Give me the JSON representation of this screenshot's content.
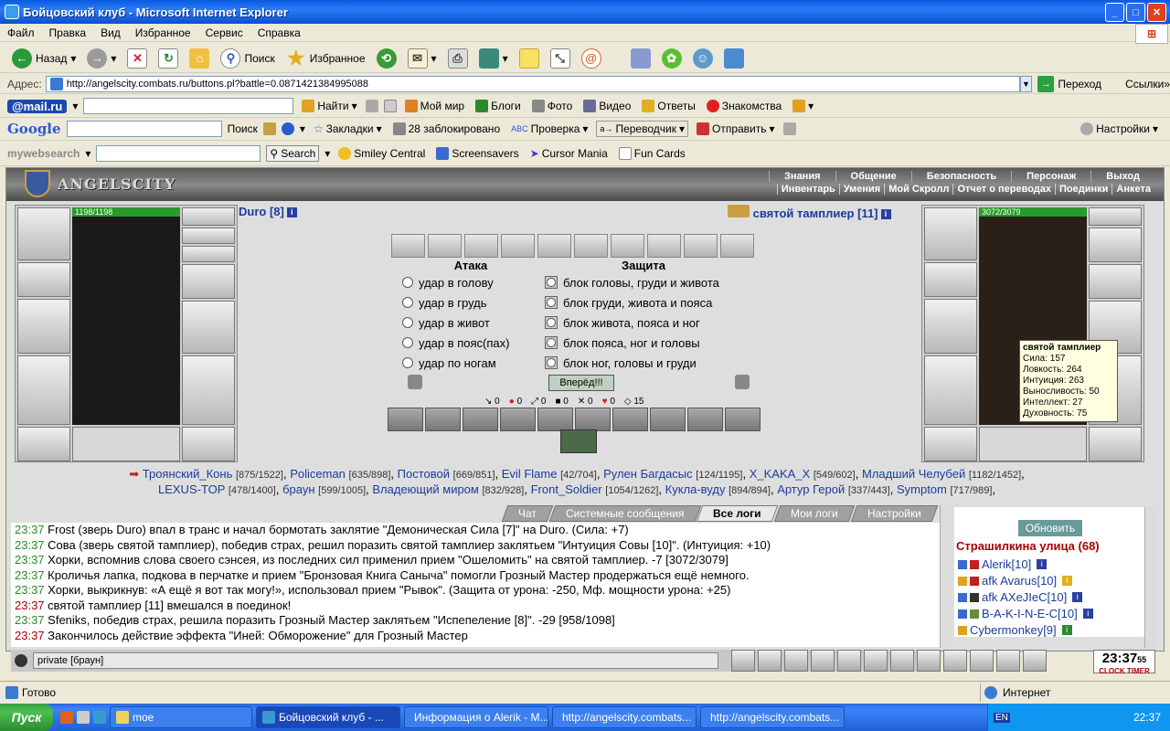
{
  "window": {
    "title": "Бойцовский клуб - Microsoft Internet Explorer"
  },
  "menu": [
    "Файл",
    "Правка",
    "Вид",
    "Избранное",
    "Сервис",
    "Справка"
  ],
  "toolbar": {
    "back": "Назад",
    "search": "Поиск",
    "favorites": "Избранное"
  },
  "address": {
    "label": "Адрес:",
    "url": "http://angelscity.combats.ru/buttons.pl?battle=0.0871421384995088",
    "go": "Переход",
    "links": "Ссылки"
  },
  "mailru_bar": {
    "brand": "@mail.ru",
    "items": [
      "Найти",
      "Мой мир",
      "Блоги",
      "Фото",
      "Видео",
      "Ответы",
      "Знакомства"
    ]
  },
  "google_bar": {
    "brand": "Google",
    "search": "Поиск",
    "bookmarks": "Закладки",
    "blocked": "28 заблокировано",
    "check": "Проверка",
    "translate": "Переводчик",
    "send": "Отправить",
    "settings": "Настройки"
  },
  "mywebsearch_bar": {
    "brand": "mywebsearch",
    "search": "Search",
    "items": [
      "Smiley Central",
      "Screensavers",
      "Cursor Mania",
      "Fun Cards"
    ]
  },
  "game": {
    "logo": "ANGELSCITY",
    "nav_top": [
      "Знания",
      "Общение",
      "Безопасность",
      "Персонаж",
      "Выход"
    ],
    "nav_sub": [
      "Инвентарь",
      "Умения",
      "Мой Скролл",
      "Отчет о переводах",
      "Поединки",
      "Анкета"
    ],
    "player_left": {
      "name": "Duro [8]",
      "hp": "1198/1198",
      "hp_fraction": 1.0
    },
    "player_right": {
      "name": "святой тамплиер [11]",
      "hp": "3072/3079",
      "hp_fraction": 0.998
    },
    "attack_header": "Атака",
    "defense_header": "Защита",
    "attacks": [
      "удар в голову",
      "удар в грудь",
      "удар в живот",
      "удар в пояс(пах)",
      "удар по ногам"
    ],
    "defenses": [
      "блок головы, груди и живота",
      "блок груди, живота и пояса",
      "блок живота, пояса и ног",
      "блок пояса, ног и головы",
      "блок ног, головы и груди"
    ],
    "forward_button": "Вперёд!!!",
    "stats": [
      "0",
      "0",
      "0",
      "0",
      "0",
      "0",
      "15"
    ],
    "tooltip": {
      "title": "святой тамплиер",
      "lines": [
        "Сила: 157",
        "Ловкость: 264",
        "Интуиция: 263",
        "Выносливость: 50",
        "Интеллект: 27",
        "Духовность: 75"
      ]
    },
    "players_line1": [
      {
        "n": "Троянский_Конь",
        "l": "[875/1522]"
      },
      {
        "n": "Policeman",
        "l": "[635/898]"
      },
      {
        "n": "Постовой",
        "l": "[669/851]"
      },
      {
        "n": "Evil Flame",
        "l": "[42/704]"
      },
      {
        "n": "Рулен Багдасыс",
        "l": "[124/1195]"
      },
      {
        "n": "X_KAKA_X",
        "l": "[549/602]"
      },
      {
        "n": "Младший Челубей",
        "l": "[1182/1452]"
      }
    ],
    "players_line2": [
      {
        "n": "LEXUS-TOP",
        "l": "[478/1400]"
      },
      {
        "n": "браун",
        "l": "[599/1005]"
      },
      {
        "n": "Владеющий миром",
        "l": "[832/928]"
      },
      {
        "n": "Front_Soldier",
        "l": "[1054/1262]"
      },
      {
        "n": "Кукла-вуду",
        "l": "[894/894]"
      },
      {
        "n": "Артур Герой",
        "l": "[337/443]"
      },
      {
        "n": "Symptom",
        "l": "[717/989]"
      }
    ]
  },
  "chat": {
    "tabs": [
      "Чат",
      "Системные сообщения",
      "Все логи",
      "Мои логи",
      "Настройки"
    ],
    "active_tab": "Все логи",
    "log": [
      {
        "time": "23:37",
        "text": "Frost (зверь Duro) впал в транс и начал бормотать заклятие \"Демоническая Сила [7]\" на Duro. (Сила: +7)"
      },
      {
        "time": "23:37",
        "text": "Сова (зверь святой тамплиер), победив страх, решил поразить святой тамплиер заклятьем \"Интуиция Совы [10]\". (Интуиция: +10)"
      },
      {
        "time": "23:37",
        "text": "Хорки, вспомнив слова своего сэнсея, из последних сил применил прием \"Ошеломить\" на святой тамплиер. -7 [3072/3079]"
      },
      {
        "time": "23:37",
        "text": "Кроличья лапка, подкова в перчатке и прием \"Бронзовая Книга Саныча\" помогли Грозный Мастер продержаться ещё немного."
      },
      {
        "time": "23:37",
        "text": "Хорки, выкрикнув: «А ещё я вот так могу!», использовал прием \"Рывок\". (Защита от урона: -250, Мф. мощности урона: +25)"
      },
      {
        "time": "23:37",
        "text": "святой тамплиер [11] вмешался в поединок!"
      },
      {
        "time": "23:37",
        "text": "Sfeniks, победив страх, решила поразить Грозный Мастер заклятьем \"Испепеление [8]\". -29 [958/1098]"
      },
      {
        "time": "23:37",
        "text": "Закончилось действие эффекта \"Иней: Обморожение\" для Грозный Мастер"
      }
    ],
    "input_value": "private [браун]"
  },
  "userlist": {
    "refresh": "Обновить",
    "street": "Страшилкина улица (68)",
    "users": [
      "Alerik[10]",
      "afk Avarus[10]",
      "afk AXeJIeC[10]",
      "B-A-K-I-N-E-C[10]",
      "Cybermonkey[9]"
    ]
  },
  "clock": {
    "time": "23:37",
    "seconds": "55",
    "label1": "CLOCK",
    "label2": "TIMER"
  },
  "status": {
    "left": "Готово",
    "zone": "Интернет"
  },
  "taskbar": {
    "start": "Пуск",
    "tasks": [
      "moe",
      "Бойцовский клуб - ...",
      "Информация о Alerik - M...",
      "http://angelscity.combats...",
      "http://angelscity.combats..."
    ],
    "time": "22:37"
  }
}
